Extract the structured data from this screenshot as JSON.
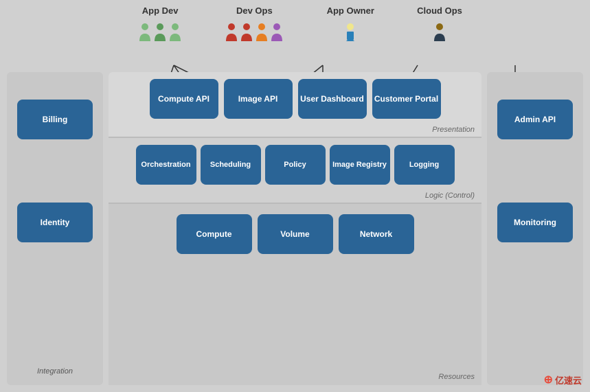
{
  "personas": [
    {
      "label": "App Dev",
      "count": 3,
      "colors": [
        "#7cb97c",
        "#5a9a5a",
        "#7cb97c"
      ],
      "x_position": "25%"
    },
    {
      "label": "Dev Ops",
      "count": 4,
      "colors": [
        "#c0392b",
        "#c0392b",
        "#e67e22",
        "#9b59b6"
      ],
      "x_position": "50%"
    },
    {
      "label": "App Owner",
      "count": 1,
      "colors": [
        "#2980b9"
      ],
      "x_position": "70%"
    },
    {
      "label": "Cloud Ops",
      "count": 1,
      "colors": [
        "#2c3e50"
      ],
      "x_position": "88%"
    }
  ],
  "left_panel": {
    "items": [
      "Billing",
      "Identity"
    ],
    "label": "Integration"
  },
  "right_panel": {
    "items": [
      "Admin API",
      "Monitoring"
    ],
    "label": ""
  },
  "presentation_layer": {
    "label": "Presentation",
    "items": [
      "Compute API",
      "Image API",
      "User Dashboard",
      "Customer Portal"
    ]
  },
  "logic_layer": {
    "label": "Logic (Control)",
    "items": [
      "Orchestration",
      "Scheduling",
      "Policy",
      "Image Registry",
      "Logging"
    ]
  },
  "resources_layer": {
    "label": "Resources",
    "items": [
      "Compute",
      "Volume",
      "Network"
    ]
  },
  "watermark": {
    "icon": "⊕",
    "text": "亿速云"
  }
}
